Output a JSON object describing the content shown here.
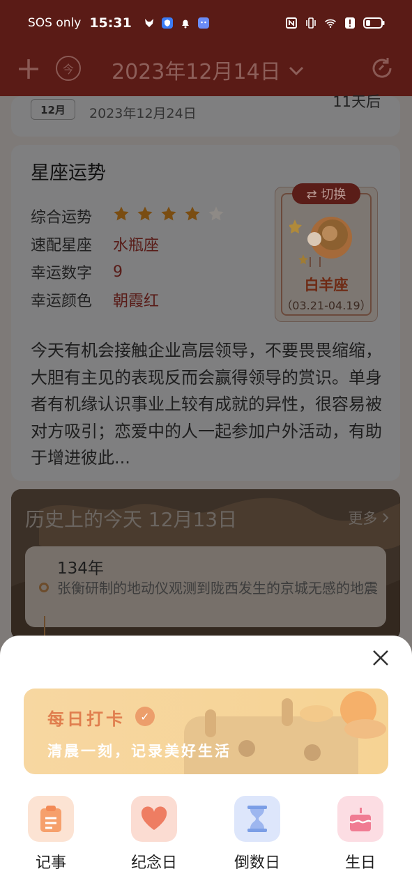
{
  "status_bar": {
    "carrier": "SOS only",
    "time": "15:31"
  },
  "app_bar": {
    "add_icon": "plus-icon",
    "today_label": "今",
    "date": "2023年12月14日",
    "refresh_icon": "refresh-icon"
  },
  "prev_card": {
    "month": "12月",
    "date": "2023年12月24日",
    "days": "11天后"
  },
  "horoscope": {
    "title": "星座运势",
    "rows": [
      {
        "label": "综合运势",
        "stars": 4,
        "max": 5
      },
      {
        "label": "速配星座",
        "value": "水瓶座"
      },
      {
        "label": "幸运数字",
        "value": "9"
      },
      {
        "label": "幸运颜色",
        "value": "朝霞红"
      }
    ],
    "switch_label": "⇄ 切换",
    "sign_name": "白羊座",
    "sign_range": "（03.21-04.19）",
    "text": "今天有机会接触企业高层领导，不要畏畏缩缩，大胆有主见的表现反而会赢得领导的赏识。单身者有机缘认识事业上较有成就的异性，很容易被对方吸引；恋爱中的人一起参加户外活动，有助于增进彼此..."
  },
  "history": {
    "title": "历史上的今天  12月13日",
    "more": "更多",
    "year": "134年",
    "event": "张衡研制的地动仪观测到陇西发生的京城无感的地震"
  },
  "sheet": {
    "banner_title": "每日打卡",
    "banner_subtitle": "清晨一刻，记录美好生活",
    "items": [
      {
        "label": "记事",
        "icon": "note-icon",
        "color": "#f7a06a"
      },
      {
        "label": "纪念日",
        "icon": "heart-icon",
        "color": "#f08a6e"
      },
      {
        "label": "倒数日",
        "icon": "hourglass-icon",
        "color": "#7b9ee6"
      },
      {
        "label": "生日",
        "icon": "cake-icon",
        "color": "#f07c93"
      }
    ]
  }
}
